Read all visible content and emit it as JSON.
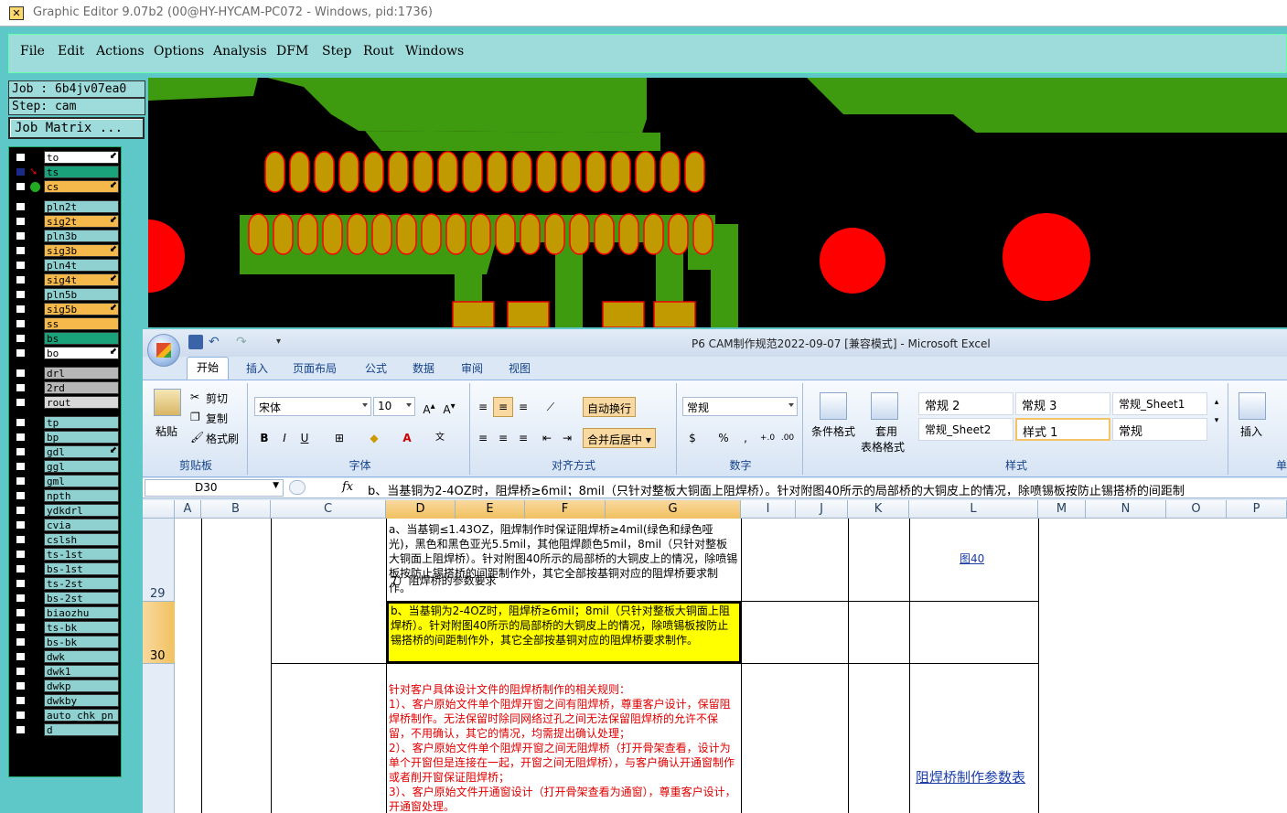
{
  "window": {
    "title": "Graphic Editor 9.07b2 (00@HY-HYCAM-PC072 - Windows, pid:1736)"
  },
  "menu": [
    "File",
    "Edit",
    "Actions",
    "Options",
    "Analysis",
    "DFM",
    "Step",
    "Rout",
    "Windows"
  ],
  "job": {
    "job_text": "Job : 6b4jv07ea0",
    "step_text": "Step: cam",
    "matrix_label": "Job Matrix ..."
  },
  "layers": [
    {
      "name": "to",
      "color": "#ffffff",
      "arrow": true
    },
    {
      "name": "ts",
      "color": "#1aa37a",
      "arrow": false,
      "pin": "red"
    },
    {
      "name": "cs",
      "color": "#f5b84a",
      "arrow": true,
      "pin": "green"
    },
    {
      "name": "pln2t",
      "color": "#8fd0d0",
      "arrow": false
    },
    {
      "name": "sig2t",
      "color": "#f5b84a",
      "arrow": true
    },
    {
      "name": "pln3b",
      "color": "#8fd0d0",
      "arrow": false
    },
    {
      "name": "sig3b",
      "color": "#f5b84a",
      "arrow": true
    },
    {
      "name": "pln4t",
      "color": "#8fd0d0",
      "arrow": false
    },
    {
      "name": "sig4t",
      "color": "#f5b84a",
      "arrow": true
    },
    {
      "name": "pln5b",
      "color": "#8fd0d0",
      "arrow": false
    },
    {
      "name": "sig5b",
      "color": "#f5b84a",
      "arrow": true
    },
    {
      "name": "ss",
      "color": "#f5b84a",
      "arrow": false
    },
    {
      "name": "bs",
      "color": "#1aa37a",
      "arrow": false
    },
    {
      "name": "bo",
      "color": "#ffffff",
      "arrow": true
    },
    {
      "name": "drl",
      "color": "#b7b7b7",
      "arrow": false
    },
    {
      "name": "2rd",
      "color": "#b7b7b7",
      "arrow": false
    },
    {
      "name": "rout",
      "color": "#d8d8d8",
      "arrow": false
    },
    {
      "name": "tp",
      "color": "#8fd0d0",
      "arrow": false
    },
    {
      "name": "bp",
      "color": "#8fd0d0",
      "arrow": false
    },
    {
      "name": "gdl",
      "color": "#8fd0d0",
      "arrow": true
    },
    {
      "name": "ggl",
      "color": "#8fd0d0",
      "arrow": false
    },
    {
      "name": "gml",
      "color": "#8fd0d0",
      "arrow": false
    },
    {
      "name": "npth",
      "color": "#8fd0d0",
      "arrow": false
    },
    {
      "name": "ydkdrl",
      "color": "#8fd0d0",
      "arrow": false
    },
    {
      "name": "cvia",
      "color": "#8fd0d0",
      "arrow": false
    },
    {
      "name": "cslsh",
      "color": "#8fd0d0",
      "arrow": false
    },
    {
      "name": "ts-1st",
      "color": "#8fd0d0",
      "arrow": false
    },
    {
      "name": "bs-1st",
      "color": "#8fd0d0",
      "arrow": false
    },
    {
      "name": "ts-2st",
      "color": "#8fd0d0",
      "arrow": false
    },
    {
      "name": "bs-2st",
      "color": "#8fd0d0",
      "arrow": false
    },
    {
      "name": "biaozhu",
      "color": "#8fd0d0",
      "arrow": false
    },
    {
      "name": "ts-bk",
      "color": "#8fd0d0",
      "arrow": false
    },
    {
      "name": "bs-bk",
      "color": "#8fd0d0",
      "arrow": false
    },
    {
      "name": "dwk",
      "color": "#8fd0d0",
      "arrow": false
    },
    {
      "name": "dwk1",
      "color": "#8fd0d0",
      "arrow": false
    },
    {
      "name": "dwkp",
      "color": "#8fd0d0",
      "arrow": false
    },
    {
      "name": "dwkby",
      "color": "#8fd0d0",
      "arrow": false
    },
    {
      "name": "auto_chk_pn",
      "color": "#8fd0d0",
      "arrow": false
    },
    {
      "name": "d",
      "color": "#8fd0d0",
      "arrow": false
    }
  ],
  "excel": {
    "title": "P6 CAM制作规范2022-09-07  [兼容模式] - Microsoft Excel",
    "tabs": [
      "开始",
      "插入",
      "页面布局",
      "公式",
      "数据",
      "审阅",
      "视图"
    ],
    "clipboard": {
      "paste": "粘贴",
      "cut": "剪切",
      "copy": "复制",
      "format_painter": "格式刷",
      "group": "剪贴板"
    },
    "font": {
      "name": "宋体",
      "size": "10",
      "bold": "B",
      "italic": "I",
      "underline": "U",
      "group": "字体"
    },
    "alignment": {
      "wrap": "自动换行",
      "merge": "合并后居中",
      "group": "对齐方式"
    },
    "number": {
      "format": "常规",
      "percent": "%",
      "comma": ",",
      "group": "数字"
    },
    "styles": {
      "conditional": "条件格式",
      "table": "套用",
      "table2": "表格格式",
      "cells": [
        "常规 2",
        "常规 3",
        "常规_Sheet1",
        "常规_Sheet2",
        "样式 1",
        "常规"
      ],
      "group": "样式"
    },
    "cells_group": {
      "insert": "插入",
      "group": "单"
    },
    "name_box": "D30",
    "fx": "fx",
    "formula": "b、当基铜为2-4OZ时，阻焊桥≥6mil；8mil（只针对整板大铜面上阻焊桥）。针对附图40所示的局部桥的大铜皮上的情况，除喷锡板按防止锡搭桥的间距制",
    "columns": [
      "A",
      "B",
      "C",
      "D",
      "E",
      "F",
      "G",
      "I",
      "J",
      "K",
      "L",
      "M",
      "N",
      "O",
      "P"
    ],
    "rows": [
      "29",
      "30"
    ],
    "c_label": "7）阻焊桥的参数要求",
    "d29": "a、当基铜≤1.43OZ，阻焊制作时保证阻焊桥≥4mil(绿色和绿色哑光)，黑色和黑色亚光5.5mil，其他阻焊颜色5mil，8mil（只针对整板大铜面上阻焊桥）。针对附图40所示的局部桥的大铜皮上的情况，除喷锡板按防止锡搭桥的间距制作外，其它全部按基铜对应的阻焊桥要求制作。",
    "d30": "b、当基铜为2-4OZ时，阻焊桥≥6mil；8mil（只针对整板大铜面上阻焊桥）。针对附图40所示的局部桥的大铜皮上的情况，除喷锡板按防止锡搭桥的间距制作外，其它全部按基铜对应的阻焊桥要求制作。",
    "l29": "图40",
    "d31": "针对客户具体设计文件的阻焊桥制作的相关规则：\n1）、客户原始文件单个阻焊开窗之间有阻焊桥，尊重客户设计，保留阻焊桥制作。无法保留时除同网络过孔之间无法保留阻焊桥的允许不保留，不用确认，其它的情况，均需提出确认处理；\n2）、客户原始文件单个阻焊开窗之间无阻焊桥（打开骨架查看，设计为单个开窗但是连接在一起，开窗之间无阻焊桥），与客户确认开通窗制作或者削开窗保证阻焊桥；\n3）、客户原始文件开通窗设计（打开骨架查看为通窗），尊重客户设计，开通窗处理。",
    "l31": "阻焊桥制作参数表"
  }
}
